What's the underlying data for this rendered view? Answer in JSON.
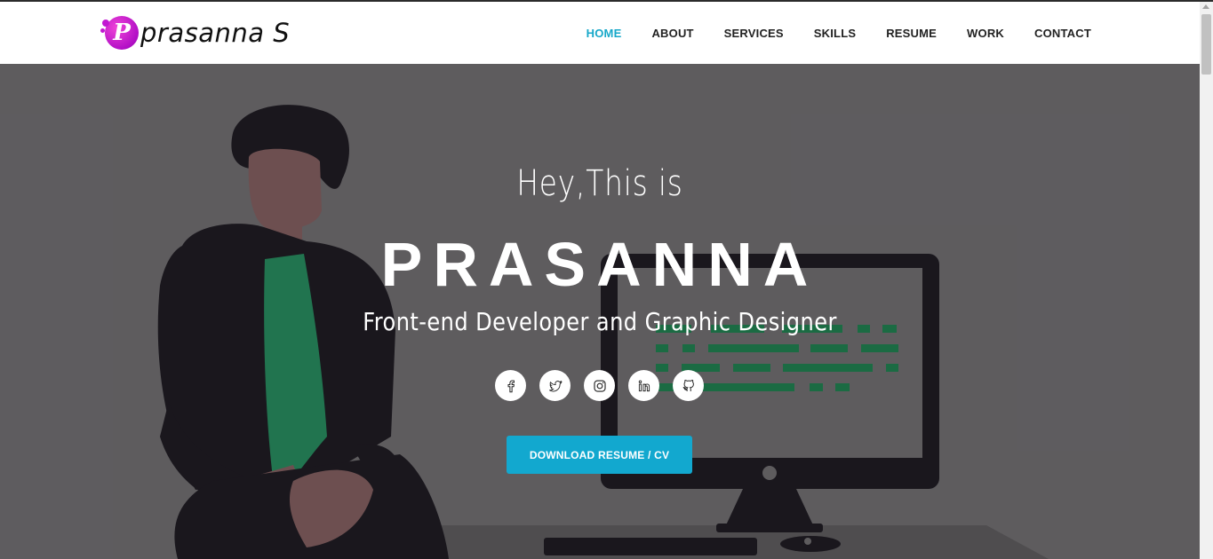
{
  "brand": {
    "logo_letter": "P",
    "name": "prasanna S",
    "accent_color": "#c218d2"
  },
  "nav": {
    "items": [
      {
        "label": "HOME",
        "active": true
      },
      {
        "label": "ABOUT",
        "active": false
      },
      {
        "label": "SERVICES",
        "active": false
      },
      {
        "label": "SKILLS",
        "active": false
      },
      {
        "label": "RESUME",
        "active": false
      },
      {
        "label": "WORK",
        "active": false
      },
      {
        "label": "CONTACT",
        "active": false
      }
    ],
    "active_color": "#17a8c9"
  },
  "hero": {
    "greeting": "Hey,This is",
    "name": "PRASANNA",
    "role": "Front-end Developer and Graphic Designer",
    "socials": [
      {
        "icon": "facebook-icon"
      },
      {
        "icon": "twitter-icon"
      },
      {
        "icon": "instagram-icon"
      },
      {
        "icon": "linkedin-icon"
      },
      {
        "icon": "github-icon"
      }
    ],
    "cta_label": "DOWNLOAD RESUME / CV",
    "cta_color": "#12a8cf",
    "background_color": "#6b696c"
  }
}
